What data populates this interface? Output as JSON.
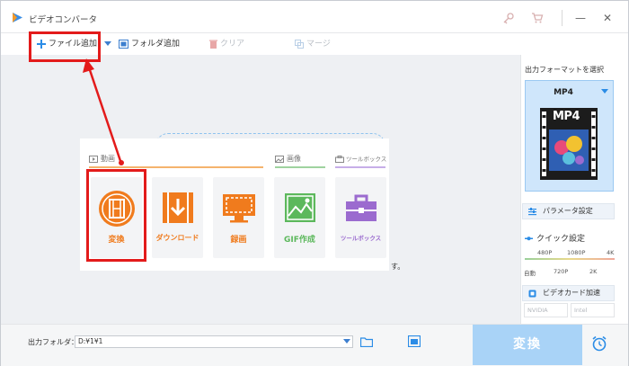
{
  "app": {
    "title": "ビデオコンバータ",
    "icons": [
      "app-logo-icon",
      "key-icon",
      "cart-icon",
      "minimize-icon",
      "close-icon"
    ]
  },
  "window_controls": {
    "minimize": "—",
    "close": "✕"
  },
  "toolbar": {
    "add_file": "ファイル追加",
    "add_folder": "フォルダ追加",
    "clear": "クリア",
    "merge": "マージ"
  },
  "main": {
    "categories": {
      "video": "動画",
      "image": "画像",
      "toolbox": "ツールボックス"
    },
    "tiles": [
      {
        "label": "変換",
        "icon": "film-reel-icon"
      },
      {
        "label": "ダウンロード",
        "icon": "download-icon"
      },
      {
        "label": "録画",
        "icon": "screen-record-icon"
      },
      {
        "label": "GIF作成",
        "icon": "image-icon"
      },
      {
        "label": "ツールボックス",
        "icon": "toolbox-icon"
      }
    ],
    "trailing_text": "す。"
  },
  "right_panel": {
    "title": "出力フォーマットを選択",
    "format": "MP4",
    "param_button": "パラメータ設定",
    "quick_setting": "クイック設定",
    "quality_top": [
      "480P",
      "1080P",
      "4K"
    ],
    "quality_bottom": [
      "自動",
      "720P",
      "2K"
    ],
    "gpu_button": "ビデオカード加速",
    "gpu_options": [
      "NVIDIA",
      "Intel"
    ]
  },
  "bottom": {
    "output_label": "出力フォルダ：",
    "output_path": "D:¥1¥1",
    "convert": "変換"
  },
  "colors": {
    "accent_blue": "#2b8ce6",
    "tile_orange": "#f07b1d",
    "gif_green": "#5cb85c",
    "toolbox_purple": "#9b6bcf",
    "highlight_red": "#e31b1b",
    "convert_button": "#a9d3f7"
  }
}
